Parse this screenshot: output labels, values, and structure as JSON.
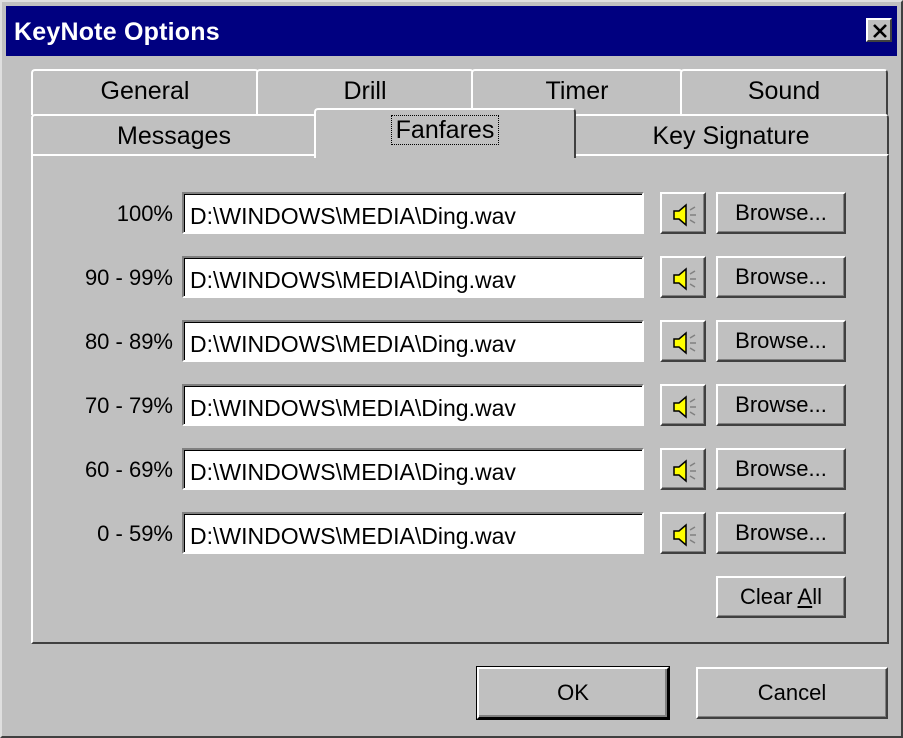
{
  "window": {
    "title": "KeyNote Options"
  },
  "tabs": {
    "row_back": [
      {
        "label": "General"
      },
      {
        "label": "Drill"
      },
      {
        "label": "Timer"
      },
      {
        "label": "Sound"
      }
    ],
    "row_front": [
      {
        "label": "Messages"
      },
      {
        "label": "Fanfares",
        "active": true
      },
      {
        "label": "Key Signature"
      }
    ]
  },
  "fanfares": {
    "rows": [
      {
        "label": "100%",
        "path": "D:\\WINDOWS\\MEDIA\\Ding.wav"
      },
      {
        "label": "90 - 99%",
        "path": "D:\\WINDOWS\\MEDIA\\Ding.wav"
      },
      {
        "label": "80 - 89%",
        "path": "D:\\WINDOWS\\MEDIA\\Ding.wav"
      },
      {
        "label": "70 - 79%",
        "path": "D:\\WINDOWS\\MEDIA\\Ding.wav"
      },
      {
        "label": "60 - 69%",
        "path": "D:\\WINDOWS\\MEDIA\\Ding.wav"
      },
      {
        "label": "0 - 59%",
        "path": "D:\\WINDOWS\\MEDIA\\Ding.wav"
      }
    ],
    "browse_label": "Browse...",
    "clear_all_prefix": "Clear ",
    "clear_all_accel": "A",
    "clear_all_suffix": "ll"
  },
  "buttons": {
    "ok": "OK",
    "cancel": "Cancel"
  },
  "icons": {
    "close": "close-icon",
    "speaker": "speaker-icon",
    "speaker_color": "#ffff00"
  }
}
